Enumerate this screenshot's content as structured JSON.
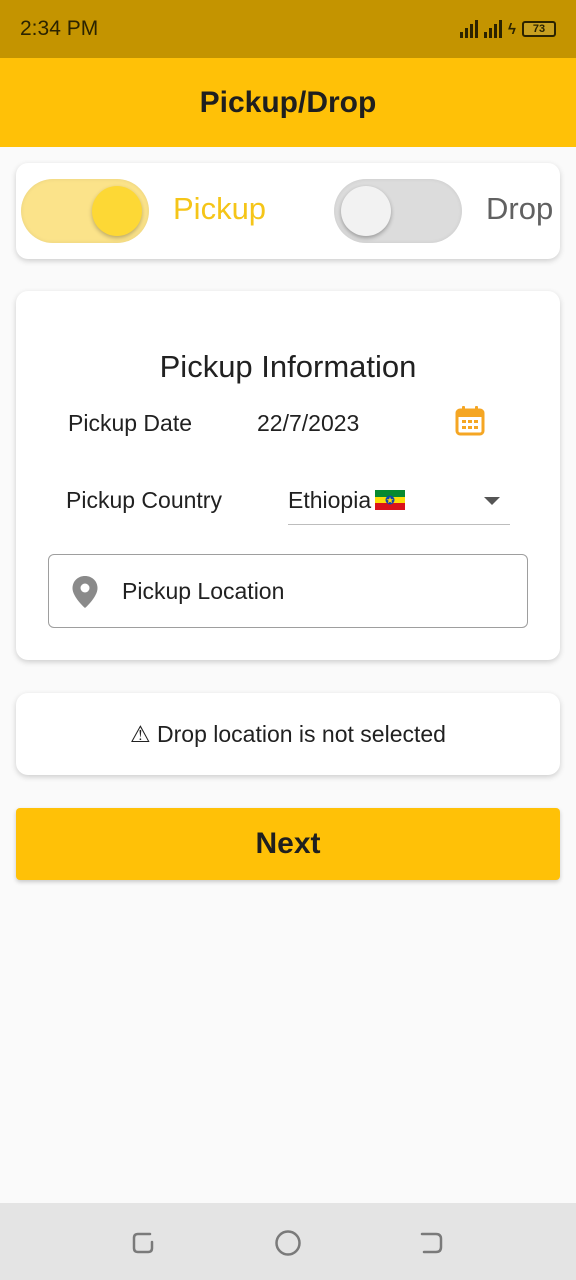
{
  "status_bar": {
    "time": "2:34 PM",
    "battery": "73"
  },
  "app_bar": {
    "title": "Pickup/Drop"
  },
  "mode_toggle": {
    "pickup_label": "Pickup",
    "pickup_on": true,
    "drop_label": "Drop",
    "drop_on": false
  },
  "pickup_info": {
    "title": "Pickup Information",
    "date_label": "Pickup Date",
    "date_value": "22/7/2023",
    "country_label": "Pickup Country",
    "country_value": "Ethiopia",
    "location_placeholder": "Pickup Location"
  },
  "drop_status": {
    "message": "⚠ Drop location is not selected"
  },
  "next_button": {
    "label": "Next"
  },
  "colors": {
    "accent": "#ffc107",
    "status_bar": "#c49400",
    "calendar_icon": "#f5a623"
  },
  "icons": [
    "signal-icon",
    "battery-icon",
    "calendar-icon",
    "dropdown-caret-icon",
    "location-pin-icon",
    "ethiopia-flag-icon",
    "nav-recents-icon",
    "nav-home-icon",
    "nav-back-icon"
  ]
}
